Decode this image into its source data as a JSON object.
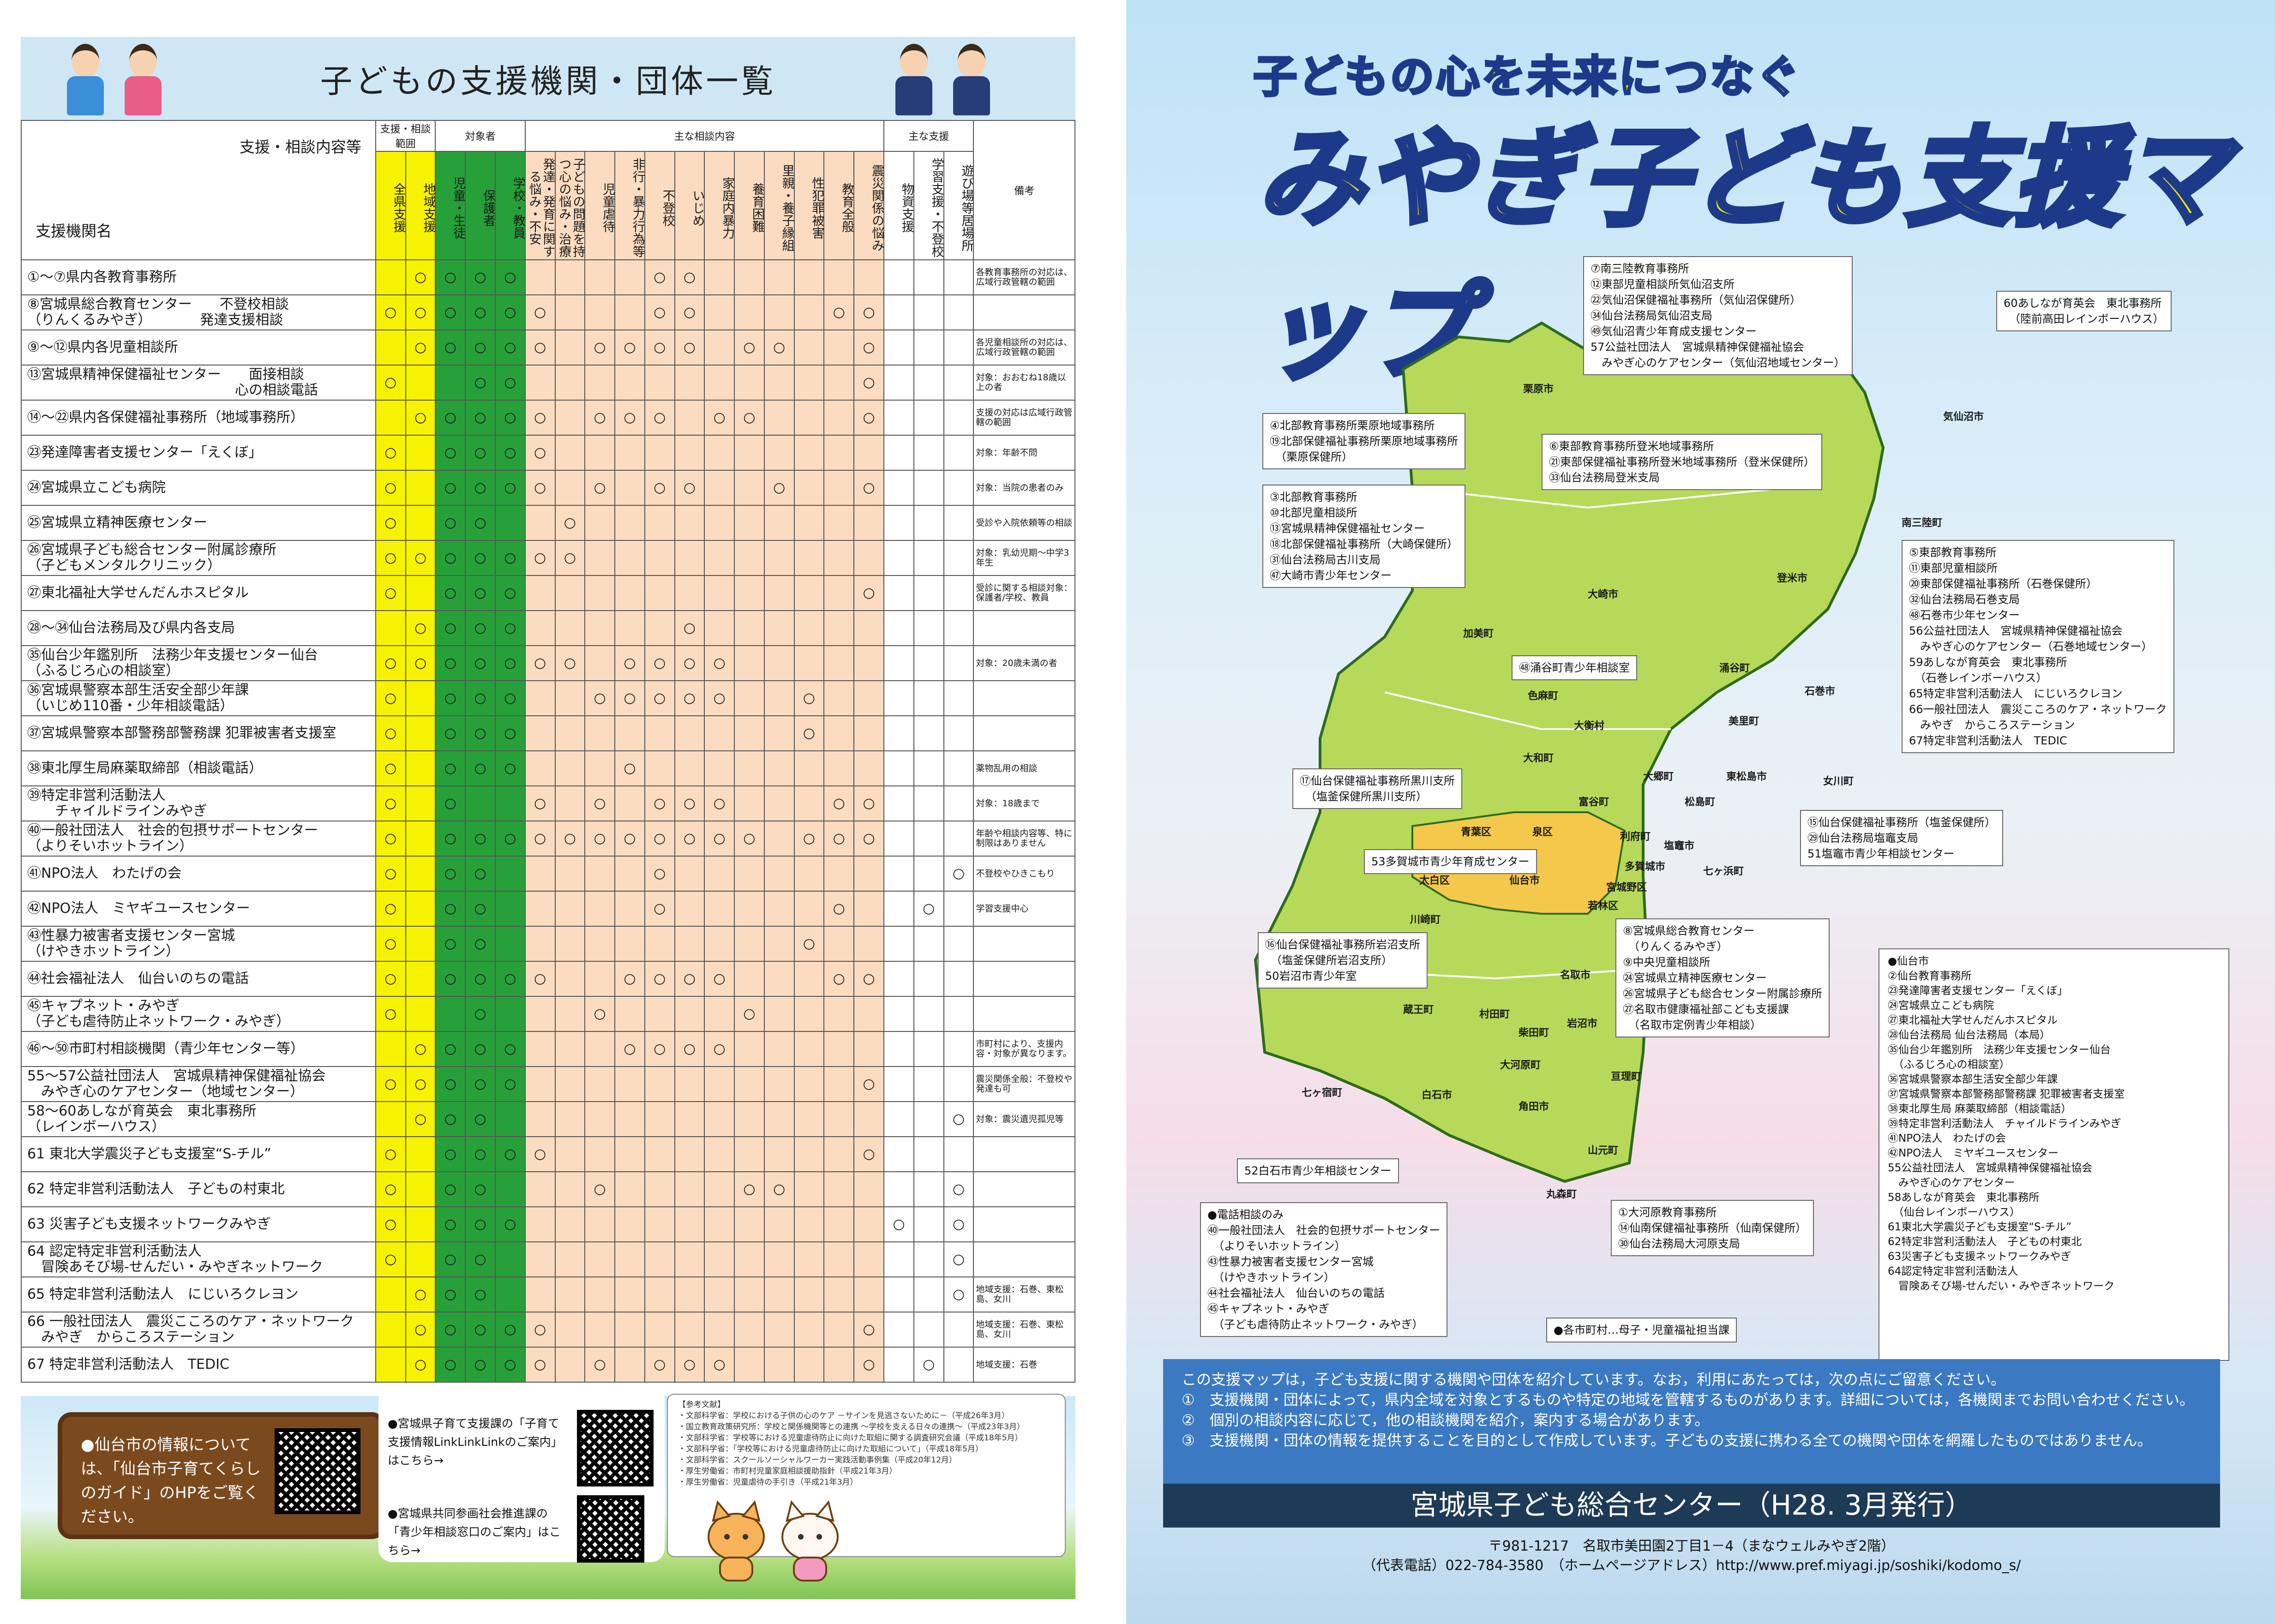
{
  "left": {
    "title": "子どもの支援機関・団体一覧",
    "table": {
      "corner_top": "支援・相談内容等",
      "corner_bottom": "支援機関名",
      "groups": [
        "支援・相談範囲",
        "対象者",
        "主な相談内容",
        "主な支援"
      ],
      "columns": [
        "全県支援",
        "地域支援",
        "児童・生徒",
        "保護者",
        "学校・教員",
        "発達・発育に関する悩み・不安",
        "子どもの問題を持つ心の悩み・治療",
        "児童虐待",
        "非行・暴力行為等",
        "不登校",
        "いじめ",
        "家庭内暴力",
        "養育困難",
        "里親・養子縁組",
        "性犯罪被害",
        "教育全般",
        "震災関係の悩み",
        "物資支援",
        "学習支援・不登校",
        "遊び場等居場所"
      ],
      "notes_header": "備考",
      "rows": [
        {
          "name": "①～⑦県内各教育事務所",
          "marks": [
            "",
            "○",
            "○",
            "○",
            "○",
            "",
            "",
            "",
            "",
            "○",
            "○",
            "",
            "",
            "",
            "",
            "",
            "",
            "",
            "",
            ""
          ],
          "note": "各教育事務所の対応は、広域行政管轄の範囲"
        },
        {
          "name": "⑧宮城県総合教育センター　　不登校相談\n（りんくるみやぎ）　　　　発達支援相談",
          "marks": [
            "○",
            "○",
            "○",
            "○",
            "○",
            "○",
            "",
            "",
            "",
            "○",
            "○",
            "",
            "",
            "",
            "",
            "○",
            "○",
            "",
            "",
            ""
          ],
          "note": ""
        },
        {
          "name": "⑨～⑫県内各児童相談所",
          "marks": [
            "",
            "○",
            "○",
            "○",
            "○",
            "○",
            "",
            "○",
            "○",
            "○",
            "○",
            "",
            "○",
            "○",
            "",
            "",
            "○",
            "",
            "",
            ""
          ],
          "note": "各児童相談所の対応は、広域行政管轄の範囲"
        },
        {
          "name": "⑬宮城県精神保健福祉センター　　面接相談\n　　　　　　　　　　　　　　　心の相談電話",
          "marks": [
            "○",
            "",
            "",
            "○",
            "○",
            "",
            "",
            "",
            "",
            "",
            "",
            "",
            "",
            "",
            "",
            "",
            "○",
            "",
            "",
            ""
          ],
          "note": "対象：おおむね18歳以上の者"
        },
        {
          "name": "⑭～㉒県内各保健福祉事務所（地域事務所）",
          "marks": [
            "",
            "○",
            "○",
            "○",
            "○",
            "○",
            "",
            "○",
            "○",
            "○",
            "",
            "○",
            "○",
            "",
            "",
            "",
            "○",
            "",
            "",
            ""
          ],
          "note": "支援の対応は広域行政管轄の範囲"
        },
        {
          "name": "㉓発達障害者支援センター「えくぼ」",
          "marks": [
            "○",
            "",
            "○",
            "○",
            "○",
            "○",
            "",
            "",
            "",
            "",
            "",
            "",
            "",
            "",
            "",
            "",
            "",
            "",
            "",
            ""
          ],
          "note": "対象：年齢不問"
        },
        {
          "name": "㉔宮城県立こども病院",
          "marks": [
            "○",
            "",
            "○",
            "○",
            "○",
            "○",
            "",
            "○",
            "",
            "○",
            "○",
            "",
            "",
            "○",
            "",
            "",
            "○",
            "",
            "",
            ""
          ],
          "note": "対象：当院の患者のみ"
        },
        {
          "name": "㉕宮城県立精神医療センター",
          "marks": [
            "○",
            "",
            "○",
            "○",
            "",
            "",
            "○",
            "",
            "",
            "",
            "",
            "",
            "",
            "",
            "",
            "",
            "",
            "",
            "",
            ""
          ],
          "note": "受診や入院依頼等の相談"
        },
        {
          "name": "㉖宮城県子ども総合センター附属診療所\n（子どもメンタルクリニック）",
          "marks": [
            "○",
            "○",
            "○",
            "○",
            "○",
            "○",
            "○",
            "",
            "",
            "",
            "",
            "",
            "",
            "",
            "",
            "",
            "",
            "",
            "",
            ""
          ],
          "note": "対象：乳幼児期～中学3年生"
        },
        {
          "name": "㉗東北福祉大学せんだんホスピタル",
          "marks": [
            "○",
            "",
            "○",
            "○",
            "○",
            "",
            "",
            "",
            "",
            "",
            "",
            "",
            "",
            "",
            "",
            "",
            "○",
            "",
            "",
            ""
          ],
          "note": "受診に関する相談対象：保護者/学校、教員"
        },
        {
          "name": "㉘～㉞仙台法務局及び県内各支局",
          "marks": [
            "",
            "○",
            "○",
            "○",
            "○",
            "",
            "",
            "",
            "",
            "",
            "○",
            "",
            "",
            "",
            "",
            "",
            "",
            "",
            "",
            ""
          ],
          "note": ""
        },
        {
          "name": "㉟仙台少年鑑別所　法務少年支援センター仙台\n（ふるじろ心の相談室）",
          "marks": [
            "○",
            "○",
            "○",
            "○",
            "○",
            "○",
            "○",
            "",
            "○",
            "○",
            "○",
            "○",
            "",
            "",
            "",
            "",
            "",
            "",
            "",
            ""
          ],
          "note": "対象：20歳未満の者"
        },
        {
          "name": "㊱宮城県警察本部生活安全部少年課\n（いじめ110番・少年相談電話）",
          "marks": [
            "○",
            "",
            "○",
            "○",
            "○",
            "",
            "",
            "○",
            "○",
            "○",
            "○",
            "○",
            "",
            "",
            "○",
            "",
            "",
            "",
            "",
            ""
          ],
          "note": ""
        },
        {
          "name": "㊲宮城県警察本部警務部警務課 犯罪被害者支援室",
          "marks": [
            "○",
            "",
            "○",
            "○",
            "○",
            "",
            "",
            "",
            "",
            "",
            "",
            "",
            "",
            "",
            "○",
            "",
            "",
            "",
            "",
            ""
          ],
          "note": ""
        },
        {
          "name": "㊳東北厚生局麻薬取締部（相談電話）",
          "marks": [
            "○",
            "",
            "○",
            "○",
            "○",
            "",
            "",
            "",
            "○",
            "",
            "",
            "",
            "",
            "",
            "",
            "",
            "",
            "",
            "",
            ""
          ],
          "note": "薬物乱用の相談"
        },
        {
          "name": "㊴特定非営利活動法人\n　　チャイルドラインみやぎ",
          "marks": [
            "○",
            "",
            "○",
            "",
            "",
            "○",
            "",
            "○",
            "",
            "○",
            "○",
            "○",
            "",
            "",
            "",
            "○",
            "○",
            "",
            "",
            ""
          ],
          "note": "対象：18歳まで"
        },
        {
          "name": "㊵一般社団法人　社会的包摂サポートセンター\n（よりそいホットライン）",
          "marks": [
            "○",
            "",
            "○",
            "○",
            "○",
            "○",
            "○",
            "○",
            "○",
            "○",
            "○",
            "○",
            "○",
            "",
            "○",
            "○",
            "○",
            "",
            "",
            ""
          ],
          "note": "年齢や相談内容等、特に制限はありません"
        },
        {
          "name": "㊶NPO法人　わたげの会",
          "marks": [
            "○",
            "",
            "○",
            "○",
            "",
            "",
            "",
            "",
            "",
            "○",
            "",
            "",
            "",
            "",
            "",
            "",
            "",
            "",
            "",
            "○"
          ],
          "note": "不登校やひきこもり"
        },
        {
          "name": "㊷NPO法人　ミヤギユースセンター",
          "marks": [
            "○",
            "",
            "○",
            "○",
            "",
            "",
            "",
            "",
            "",
            "○",
            "",
            "",
            "",
            "",
            "",
            "○",
            "",
            "",
            "○",
            ""
          ],
          "note": "学習支援中心"
        },
        {
          "name": "㊸性暴力被害者支援センター宮城\n（けやきホットライン）",
          "marks": [
            "○",
            "",
            "○",
            "○",
            "",
            "",
            "",
            "",
            "",
            "",
            "",
            "",
            "",
            "",
            "○",
            "",
            "",
            "",
            "",
            ""
          ],
          "note": ""
        },
        {
          "name": "㊹社会福祉法人　仙台いのちの電話",
          "marks": [
            "○",
            "",
            "○",
            "○",
            "○",
            "○",
            "",
            "",
            "○",
            "○",
            "○",
            "○",
            "",
            "",
            "",
            "○",
            "○",
            "",
            "",
            ""
          ],
          "note": ""
        },
        {
          "name": "㊺キャプネット・みやぎ\n（子ども虐待防止ネットワーク・みやぎ）",
          "marks": [
            "○",
            "",
            "",
            "○",
            "",
            "",
            "",
            "○",
            "",
            "",
            "",
            "",
            "○",
            "",
            "",
            "",
            "",
            "",
            "",
            ""
          ],
          "note": ""
        },
        {
          "name": "㊻～㊿市町村相談機関（青少年センター等）",
          "marks": [
            "",
            "○",
            "○",
            "○",
            "○",
            "",
            "",
            "",
            "○",
            "○",
            "○",
            "○",
            "",
            "",
            "",
            "",
            "",
            "",
            "",
            ""
          ],
          "note": "市町村により、支援内容・対象が異なります。"
        },
        {
          "name": "55～57公益社団法人　宮城県精神保健福祉協会\n　みやぎ心のケアセンター（地域センター）",
          "marks": [
            "○",
            "○",
            "○",
            "○",
            "○",
            "",
            "",
            "",
            "",
            "",
            "",
            "",
            "",
            "",
            "",
            "",
            "○",
            "",
            "",
            ""
          ],
          "note": "震災関係全般：不登校や発達も可"
        },
        {
          "name": "58～60あしなが育英会　東北事務所\n（レインボーハウス）",
          "marks": [
            "",
            "○",
            "○",
            "○",
            "",
            "",
            "",
            "",
            "",
            "",
            "",
            "",
            "",
            "",
            "",
            "",
            "",
            "",
            "",
            "○"
          ],
          "note": "対象：震災遺児孤児等"
        },
        {
          "name": "61 東北大学震災子ども支援室“S-チル”",
          "marks": [
            "○",
            "",
            "○",
            "○",
            "○",
            "○",
            "",
            "",
            "",
            "",
            "",
            "",
            "",
            "",
            "",
            "",
            "○",
            "",
            "",
            ""
          ],
          "note": ""
        },
        {
          "name": "62 特定非営利活動法人　子どもの村東北",
          "marks": [
            "○",
            "",
            "○",
            "○",
            "",
            "",
            "",
            "○",
            "",
            "",
            "",
            "",
            "○",
            "○",
            "",
            "",
            "",
            "",
            "",
            "○"
          ],
          "note": ""
        },
        {
          "name": "63 災害子ども支援ネットワークみやぎ",
          "marks": [
            "○",
            "",
            "○",
            "○",
            "○",
            "",
            "",
            "",
            "",
            "",
            "",
            "",
            "",
            "",
            "",
            "",
            "",
            "○",
            "",
            "○"
          ],
          "note": ""
        },
        {
          "name": "64 認定特定非営利活動法人\n　冒険あそび場-せんだい・みやぎネットワーク",
          "marks": [
            "○",
            "",
            "○",
            "○",
            "",
            "",
            "",
            "",
            "",
            "",
            "",
            "",
            "",
            "",
            "",
            "",
            "",
            "",
            "",
            "○"
          ],
          "note": ""
        },
        {
          "name": "65 特定非営利活動法人　にじいろクレヨン",
          "marks": [
            "",
            "○",
            "○",
            "○",
            "",
            "",
            "",
            "",
            "",
            "",
            "",
            "",
            "",
            "",
            "",
            "",
            "",
            "",
            "",
            "○"
          ],
          "note": "地域支援：石巻、東松島、女川"
        },
        {
          "name": "66 一般社団法人　震災こころのケア・ネットワーク\n　みやぎ　からころステーション",
          "marks": [
            "",
            "○",
            "○",
            "○",
            "○",
            "○",
            "",
            "",
            "",
            "",
            "",
            "",
            "",
            "",
            "",
            "",
            "○",
            "",
            "",
            ""
          ],
          "note": "地域支援：石巻、東松島、女川"
        },
        {
          "name": "67 特定非営利活動法人　TEDIC",
          "marks": [
            "",
            "○",
            "○",
            "○",
            "○",
            "○",
            "",
            "○",
            "",
            "○",
            "○",
            "○",
            "",
            "",
            "",
            "",
            "○",
            "",
            "○",
            ""
          ],
          "note": "地域支援：石巻"
        }
      ]
    },
    "bottom": {
      "sendai_sign": "●仙台市の情報については、「仙台市子育てくらしのガイド」のHPをご覧ください。",
      "info1": "●宮城県子育て支援課の「子育て支援情報LinkLinkLinkのご案内」はこちら→",
      "info2": "●宮城県共同参画社会推進課の「青少年相談窓口のご案内」はこちら→",
      "references": "【参考文献】\n・文部科学省：学校における子供の心のケア －サインを見逃さないために－（平成26年3月）\n・国立教育政策研究所：学校と関係機関等との連携 ～学校を支える日々の連携～（平成23年3月）\n・文部科学省：学校等における児童虐待防止に向けた取組に関する調査研究会議（平成18年5月）\n・文部科学省：「学校等における児童虐待防止に向けた取組について」（平成18年5月）\n・文部科学省：スクールソーシャルワーカー実践活動事例集（平成20年12月）\n・厚生労働省：市町村児童家庭相談援助指針（平成21年3月）\n・厚生労働省：児童虐待の手引き（平成21年3月）"
    }
  },
  "right": {
    "subtitle": "子どもの心を未来につなぐ",
    "title": "みやぎ子ども支援マップ",
    "map_labels": [
      {
        "text": "栗原市"
      },
      {
        "text": "気仙沼市"
      },
      {
        "text": "南三陸町"
      },
      {
        "text": "登米市"
      },
      {
        "text": "大崎市"
      },
      {
        "text": "加美町"
      },
      {
        "text": "涌谷町"
      },
      {
        "text": "美里町"
      },
      {
        "text": "石巻市"
      },
      {
        "text": "色麻町"
      },
      {
        "text": "大衡村"
      },
      {
        "text": "大和町"
      },
      {
        "text": "大郷町"
      },
      {
        "text": "東松島市"
      },
      {
        "text": "松島町"
      },
      {
        "text": "女川町"
      },
      {
        "text": "富谷町"
      },
      {
        "text": "利府町"
      },
      {
        "text": "塩竈市"
      },
      {
        "text": "多賀城市"
      },
      {
        "text": "七ヶ浜町"
      },
      {
        "text": "青葉区"
      },
      {
        "text": "泉区"
      },
      {
        "text": "宮城野区"
      },
      {
        "text": "太白区"
      },
      {
        "text": "仙台市"
      },
      {
        "text": "若林区"
      },
      {
        "text": "川崎町"
      },
      {
        "text": "名取市"
      },
      {
        "text": "蔵王町"
      },
      {
        "text": "村田町"
      },
      {
        "text": "柴田町"
      },
      {
        "text": "岩沼市"
      },
      {
        "text": "七ヶ宿町"
      },
      {
        "text": "白石市"
      },
      {
        "text": "大河原町"
      },
      {
        "text": "亘理町"
      },
      {
        "text": "角田市"
      },
      {
        "text": "山元町"
      },
      {
        "text": "丸森町"
      }
    ],
    "callouts": [
      {
        "text": "⑦南三陸教育事務所\n⑫東部児童相談所気仙沼支所\n㉒気仙沼保健福祉事務所（気仙沼保健所）\n㉞仙台法務局気仙沼支局\n㊾気仙沼青少年育成支援センター\n57公益社団法人　宮城県精神保健福祉協会\n　みやぎ心のケアセンター（気仙沼地域センター）"
      },
      {
        "text": "60あしなが育英会　東北事務所\n　（陸前高田レインボーハウス）"
      },
      {
        "text": "④北部教育事務所栗原地域事務所\n⑲北部保健福祉事務所栗原地域事務所\n　（栗原保健所）"
      },
      {
        "text": "⑥東部教育事務所登米地域事務所\n㉑東部保健福祉事務所登米地域事務所（登米保健所）\n㉝仙台法務局登米支局"
      },
      {
        "text": "③北部教育事務所\n⑩北部児童相談所\n⑬宮城県精神保健福祉センター\n⑱北部保健福祉事務所（大崎保健所）\n㉛仙台法務局古川支局\n㊼大崎市青少年センター"
      },
      {
        "text": "⑤東部教育事務所\n⑪東部児童相談所\n⑳東部保健福祉事務所（石巻保健所）\n㉜仙台法務局石巻支局\n㊽石巻市少年センター\n56公益社団法人　宮城県精神保健福祉協会\n　みやぎ心のケアセンター（石巻地域センター）\n59あしなが育英会　東北事務所\n　（石巻レインボーハウス）\n65特定非営利活動法人　にじいろクレヨン\n66一般社団法人　震災こころのケア・ネットワーク\n　みやぎ　からころステーション\n67特定非営利活動法人　TEDIC"
      },
      {
        "text": "㊽涌谷町青少年相談室"
      },
      {
        "text": "⑰仙台保健福祉事務所黒川支所\n　（塩釜保健所黒川支所）"
      },
      {
        "text": "⑮仙台保健福祉事務所（塩釜保健所）\n㉙仙台法務局塩竈支局\n51塩竈市青少年相談センター"
      },
      {
        "text": "53多賀城市青少年育成センター"
      },
      {
        "text": "⑯仙台保健福祉事務所岩沼支所\n　（塩釜保健所岩沼支所）\n50岩沼市青少年室"
      },
      {
        "text": "⑧宮城県総合教育センター\n　（りんくるみやぎ）\n⑨中央児童相談所\n㉔宮城県立精神医療センター\n㉖宮城県子ども総合センター附属診療所\n㉗名取市健康福祉部こども支援課\n　（名取市定例青少年相談）"
      },
      {
        "text": "52白石市青少年相談センター"
      },
      {
        "text": "①大河原教育事務所\n⑭仙南保健福祉事務所（仙南保健所）\n㉚仙台法務局大河原支局"
      },
      {
        "text": "●電話相談のみ\n㊵一般社団法人　社会的包摂サポートセンター\n　（よりそいホットライン）\n㊸性暴力被害者支援センター宮城\n　（けやきホットライン）\n㊹社会福祉法人　仙台いのちの電話\n㊺キャプネット・みやぎ\n　（子ども虐待防止ネットワーク・みやぎ）"
      },
      {
        "text": "●各市町村…母子・児童福祉担当課"
      }
    ],
    "sendai_list": "●仙台市\n②仙台教育事務所\n㉓発達障害者支援センター「えくぼ」\n㉔宮城県立こども病院\n㉗東北福祉大学せんだんホスピタル\n㉘仙台法務局 仙台法務局（本局）\n㉟仙台少年鑑別所　法務少年支援センター仙台\n　（ふるじろ心の相談室）\n㊱宮城県警察本部生活安全部少年課\n㊲宮城県警察本部警務部警務課 犯罪被害者支援室\n㊳東北厚生局 麻薬取締部（相談電話）\n㊴特定非営利活動法人　チャイルドラインみやぎ\n㊶NPO法人　わたげの会\n㊷NPO法人　ミヤギユースセンター\n55公益社団法人　宮城県精神保健福祉協会\n　みやぎ心のケアセンター\n58あしなが育英会　東北事務所\n　（仙台レインボーハウス）\n61東北大学震災子ども支援室“S-チル”\n62特定非営利活動法人　子どもの村東北\n63災害子ども支援ネットワークみやぎ\n64認定特定非営利活動法人\n　冒険あそび場-せんだい・みやぎネットワーク",
    "notice": [
      "この支援マップは，子ども支援に関する機関や団体を紹介しています。なお，利用にあたっては，次の点にご留意ください。",
      "①　支援機関・団体によって，県内全域を対象とするものや特定の地域を管轄するものがあります。詳細については，各機関までお問い合わせください。",
      "②　個別の相談内容に応じて，他の相談機関を紹介，案内する場合があります。",
      "③　支援機関・団体の情報を提供することを目的として作成しています。子どもの支援に携わる全ての機関や団体を網羅したものではありません。"
    ],
    "org": "宮城県子ども総合センター（H28. 3月発行）",
    "address": "〒981-1217　名取市美田園2丁目1－4（まなウェルみやぎ2階）",
    "contact": "（代表電話）022-784-3580　（ホームページアドレス）http://www.pref.miyagi.jp/soshiki/kodomo_s/"
  }
}
